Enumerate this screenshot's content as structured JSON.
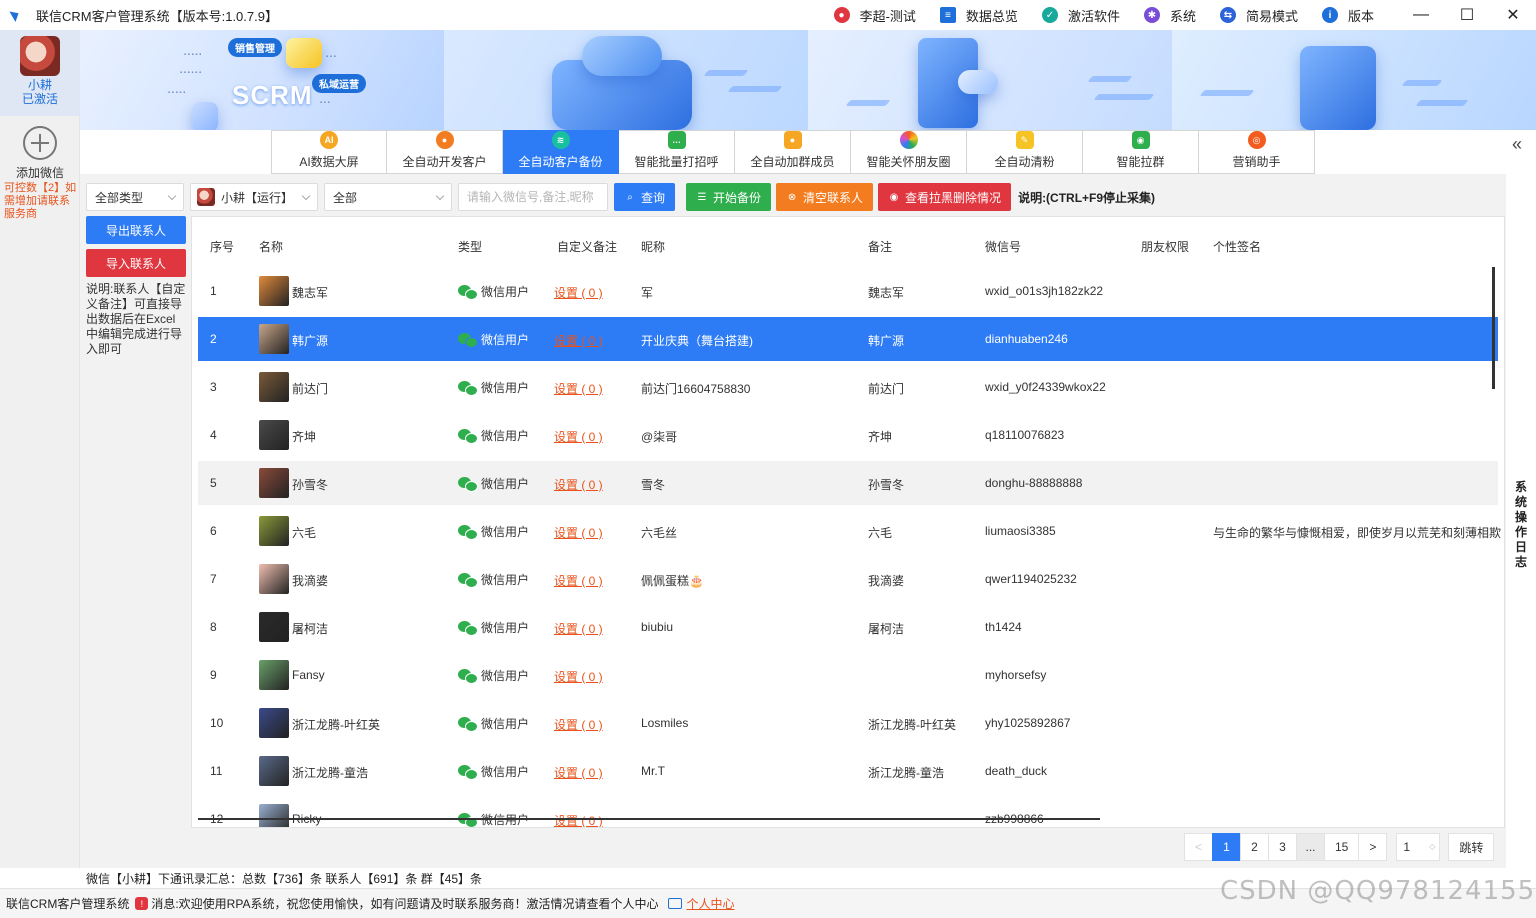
{
  "titlebar": {
    "app_title": "联信CRM客户管理系统【版本号:1.0.7.9】",
    "items": [
      {
        "label": "李超-测试",
        "icon": "user-icon",
        "color": "#e0363f"
      },
      {
        "label": "数据总览",
        "icon": "document-icon",
        "color": "#1e6fd9"
      },
      {
        "label": "激活软件",
        "icon": "shield-icon",
        "color": "#18a99a"
      },
      {
        "label": "系统",
        "icon": "gear-icon",
        "color": "#7a4dd8"
      },
      {
        "label": "简易模式",
        "icon": "switch-icon",
        "color": "#2d63d8"
      },
      {
        "label": "版本",
        "icon": "info-icon",
        "color": "#1e6fd9"
      }
    ]
  },
  "sidebar": {
    "account_name": "小耕",
    "account_status": "已激活",
    "add_wechat": "添加微信",
    "control_note": "可控数【2】如需增加请联系服务商"
  },
  "banner": {
    "tags": [
      "销售管理",
      "私域运营"
    ],
    "scrm": "SCRM"
  },
  "tabs": [
    {
      "label": "AI数据大屏",
      "icon": "ai-icon",
      "color": "#f5a623"
    },
    {
      "label": "全自动开发客户",
      "icon": "person-icon",
      "color": "#f27c1f"
    },
    {
      "label": "全自动客户备份",
      "icon": "database-icon",
      "color": "#18c0a0"
    },
    {
      "label": "智能批量打招呼",
      "icon": "chat-icon",
      "color": "#2fae4e"
    },
    {
      "label": "全自动加群成员",
      "icon": "group-icon",
      "color": "#f5a623"
    },
    {
      "label": "智能关怀朋友圈",
      "icon": "aperture-icon",
      "color": "#d94fd0"
    },
    {
      "label": "全自动清粉",
      "icon": "broom-icon",
      "color": "#f5c323"
    },
    {
      "label": "智能拉群",
      "icon": "wechat-icon",
      "color": "#2fae4e"
    },
    {
      "label": "营销助手",
      "icon": "target-icon",
      "color": "#f25c1f"
    }
  ],
  "active_tab": 2,
  "toolbar": {
    "type_select": "全部类型",
    "account_select": "小耕【运行】",
    "range_select": "全部",
    "search_placeholder": "请输入微信号,备注,昵称",
    "query": "查询",
    "start_backup": "开始备份",
    "clear_contacts": "清空联系人",
    "view_blocked": "查看拉黑删除情况",
    "hint": "说明:(CTRL+F9停止采集)"
  },
  "side": {
    "export": "导出联系人",
    "import": "导入联系人",
    "note": "说明:联系人【自定义备注】可直接导出数据后在Excel中编辑完成进行导入即可"
  },
  "table": {
    "columns": [
      "序号",
      "名称",
      "类型",
      "自定义备注",
      "昵称",
      "备注",
      "微信号",
      "朋友权限",
      "个性签名"
    ],
    "rows": [
      {
        "no": "1",
        "name": "魏志军",
        "type": "微信用户",
        "custom": "设置 ( 0 )",
        "nick": "军",
        "remark": "魏志军",
        "wxid": "wxid_o01s3jh182zk22",
        "perm": "",
        "sign": "",
        "avatar": "#e08a3c"
      },
      {
        "no": "2",
        "name": "韩广源",
        "type": "微信用户",
        "custom": "设置 ( 0 )",
        "nick": "开业庆典（舞台搭建)",
        "remark": "韩广源",
        "wxid": "dianhuaben246",
        "perm": "",
        "sign": "",
        "avatar": "#c9a68a"
      },
      {
        "no": "3",
        "name": "前达门",
        "type": "微信用户",
        "custom": "设置 ( 0 )",
        "nick": "前达门16604758830",
        "remark": "前达门",
        "wxid": "wxid_y0f24339wkox22",
        "perm": "",
        "sign": "",
        "avatar": "#7a5a3a"
      },
      {
        "no": "4",
        "name": "齐坤",
        "type": "微信用户",
        "custom": "设置 ( 0 )",
        "nick": "@柒哥",
        "remark": "齐坤",
        "wxid": "q18110076823",
        "perm": "",
        "sign": "",
        "avatar": "#4a4a4a"
      },
      {
        "no": "5",
        "name": "孙雪冬",
        "type": "微信用户",
        "custom": "设置 ( 0 )",
        "nick": "雪冬",
        "remark": "孙雪冬",
        "wxid": "donghu-88888888",
        "perm": "",
        "sign": "",
        "avatar": "#8a4a3a"
      },
      {
        "no": "6",
        "name": "六毛",
        "type": "微信用户",
        "custom": "设置 ( 0 )",
        "nick": "六毛丝",
        "remark": "六毛",
        "wxid": "liumaosi3385",
        "perm": "",
        "sign": "与生命的繁华与慷慨相爱，即使岁月以荒芜和刻薄相欺",
        "avatar": "#8a9a3a"
      },
      {
        "no": "7",
        "name": "我滴婆",
        "type": "微信用户",
        "custom": "设置 ( 0 )",
        "nick": "佩佩蛋糕🎂",
        "remark": "我滴婆",
        "wxid": "qwer1194025232",
        "perm": "",
        "sign": "",
        "avatar": "#f0c0b0"
      },
      {
        "no": "8",
        "name": "屠柯洁",
        "type": "微信用户",
        "custom": "设置 ( 0 )",
        "nick": "biubiu",
        "remark": "屠柯洁",
        "wxid": "th1424",
        "perm": "",
        "sign": "",
        "avatar": "#2a2a2a"
      },
      {
        "no": "9",
        "name": "Fansy",
        "type": "微信用户",
        "custom": "设置 ( 0 )",
        "nick": "",
        "remark": "",
        "wxid": "myhorsefsy",
        "perm": "",
        "sign": "",
        "avatar": "#6aa06a"
      },
      {
        "no": "10",
        "name": "浙江龙腾-叶红英",
        "type": "微信用户",
        "custom": "设置 ( 0 )",
        "nick": "Losmiles",
        "remark": "浙江龙腾-叶红英",
        "wxid": "yhy1025892867",
        "perm": "",
        "sign": "",
        "avatar": "#3a4a8a"
      },
      {
        "no": "11",
        "name": "浙江龙腾-童浩",
        "type": "微信用户",
        "custom": "设置 ( 0 )",
        "nick": "Mr.T",
        "remark": "浙江龙腾-童浩",
        "wxid": "death_duck",
        "perm": "",
        "sign": "",
        "avatar": "#5a6a8a"
      },
      {
        "no": "12",
        "name": "Ricky",
        "type": "微信用户",
        "custom": "设置 ( 0 )",
        "nick": "",
        "remark": "",
        "wxid": "zzb998866",
        "perm": "",
        "sign": "",
        "avatar": "#9ab0d0"
      }
    ],
    "selected_row": 1,
    "hover_row": 4
  },
  "pager": {
    "prev": "<",
    "pages": [
      "1",
      "2",
      "3",
      "...",
      "15"
    ],
    "next": ">",
    "current_input": "1",
    "jump": "跳转"
  },
  "summary": "微信【小耕】下通讯录汇总：总数【736】条 联系人【691】条 群【45】条",
  "right_rail": "系统操作日志",
  "statusbar": {
    "app": "联信CRM客户管理系统",
    "message": "消息:欢迎使用RPA系统，祝您使用愉快，如有问题请及时联系服务商！激活情况请查看个人中心",
    "personal_center": "个人中心"
  },
  "watermark": "CSDN @QQ978124155"
}
